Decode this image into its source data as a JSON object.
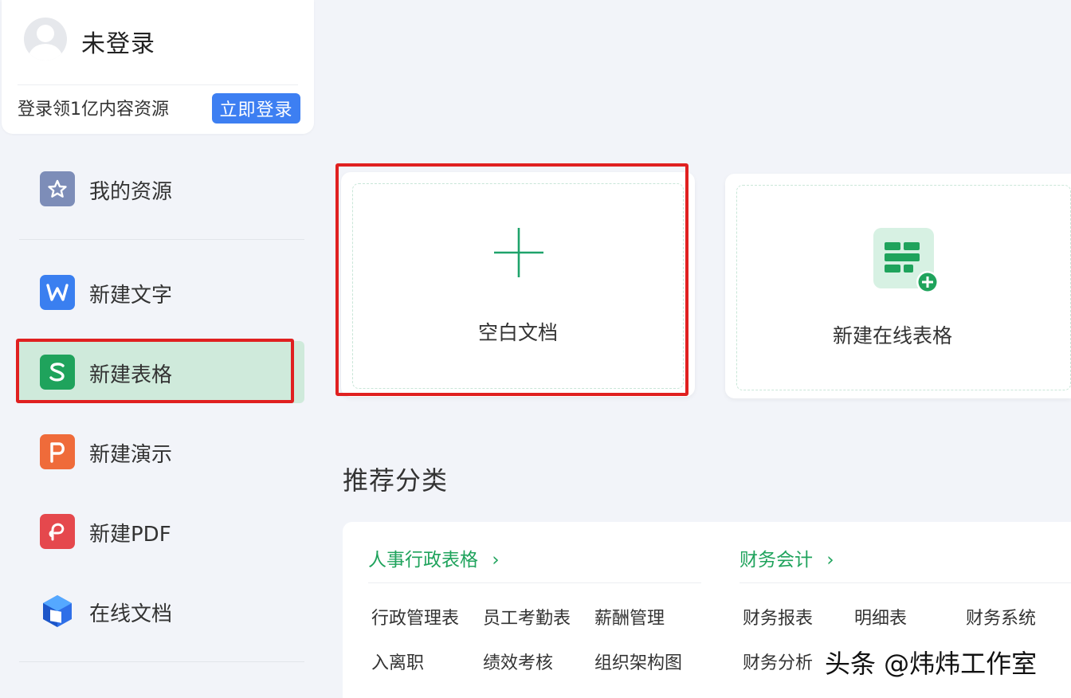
{
  "user": {
    "name": "未登录",
    "promo": "登录领1亿内容资源",
    "login_button": "立即登录"
  },
  "sidebar": {
    "items": [
      {
        "label": "我的资源",
        "icon": "star-icon"
      },
      {
        "label": "新建文字",
        "icon": "word-icon"
      },
      {
        "label": "新建表格",
        "icon": "sheet-icon"
      },
      {
        "label": "新建演示",
        "icon": "presentation-icon"
      },
      {
        "label": "新建PDF",
        "icon": "pdf-icon"
      },
      {
        "label": "在线文档",
        "icon": "online-doc-icon"
      }
    ]
  },
  "main": {
    "cards": [
      {
        "label": "空白文档",
        "icon": "plus-icon"
      },
      {
        "label": "新建在线表格",
        "icon": "online-sheet-icon"
      }
    ],
    "section_title": "推荐分类",
    "categories": [
      {
        "title": "人事行政表格",
        "links": [
          "行政管理表",
          "员工考勤表",
          "薪酬管理",
          "入离职",
          "绩效考核",
          "组织架构图"
        ]
      },
      {
        "title": "财务会计",
        "links": [
          "财务报表",
          "明细表",
          "财务系统",
          "财务分析",
          "",
          ""
        ]
      }
    ],
    "chevron": "›"
  },
  "watermark": "头条 @炜炜工作室",
  "colors": {
    "accent_green": "#1fa35c",
    "login_blue": "#3d7ff2",
    "highlight_red": "#e02020",
    "active_bg": "#cfeadb"
  }
}
